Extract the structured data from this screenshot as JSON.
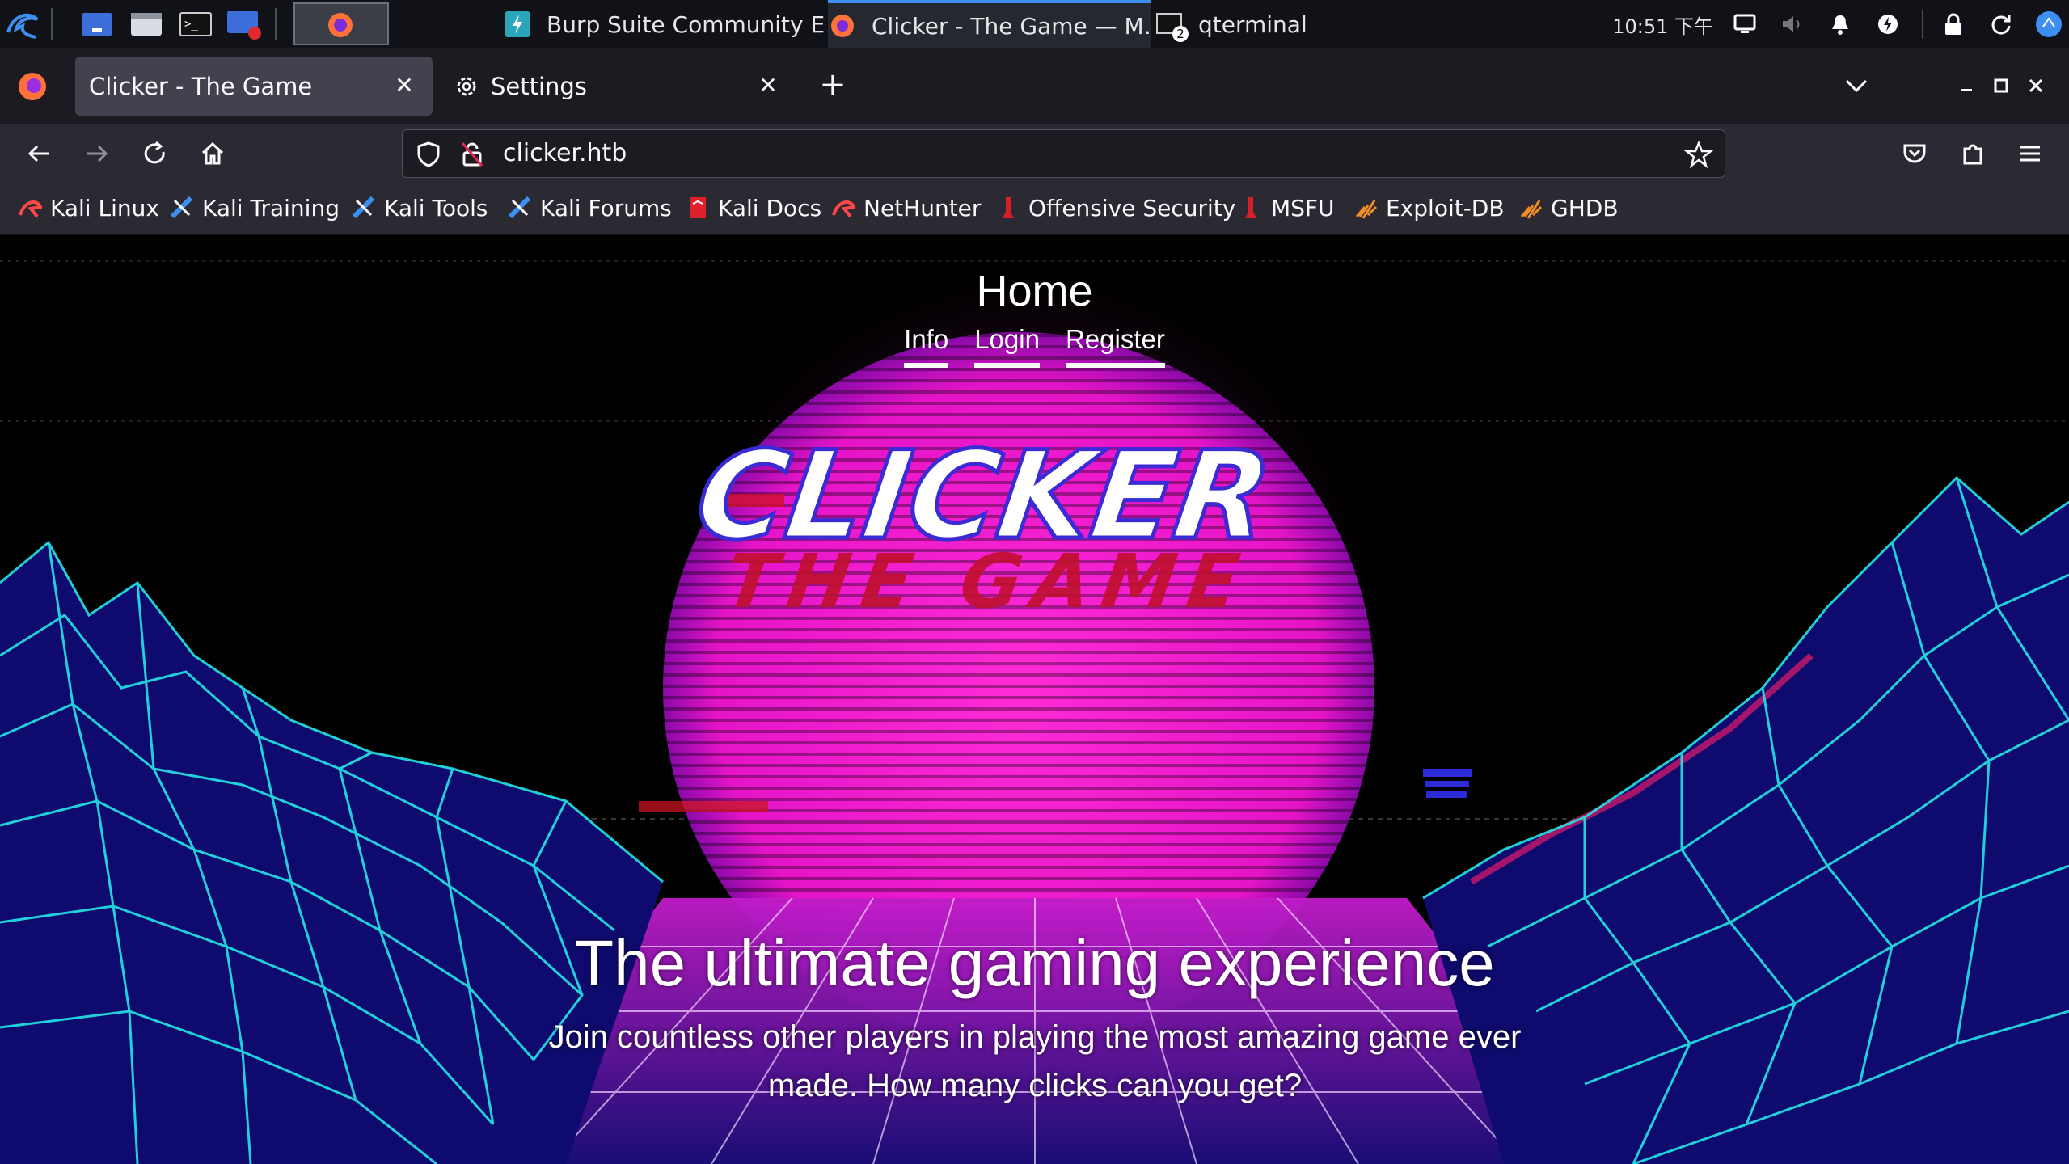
{
  "taskbar": {
    "tasks": [
      {
        "label": "Burp Suite Community E…",
        "icon": "burp-icon"
      },
      {
        "label": "Clicker - The Game — M…",
        "icon": "firefox-icon"
      },
      {
        "label": "qterminal",
        "icon": "terminal-icon",
        "badge": "2"
      }
    ],
    "clock": "10:51 下午"
  },
  "browser": {
    "tabs": [
      {
        "label": "Clicker - The Game",
        "active": true
      },
      {
        "label": "Settings",
        "icon": "gear-icon"
      }
    ],
    "url": "clicker.htb",
    "bookmarks": [
      {
        "label": "Kali Linux",
        "icon": "kali-dragon-icon"
      },
      {
        "label": "Kali Training",
        "icon": "kali-training-icon"
      },
      {
        "label": "Kali Tools",
        "icon": "kali-tools-icon"
      },
      {
        "label": "Kali Forums",
        "icon": "kali-forums-icon"
      },
      {
        "label": "Kali Docs",
        "icon": "kali-docs-icon"
      },
      {
        "label": "NetHunter",
        "icon": "nethunter-icon"
      },
      {
        "label": "Offensive Security",
        "icon": "offsec-icon"
      },
      {
        "label": "MSFU",
        "icon": "offsec-icon"
      },
      {
        "label": "Exploit-DB",
        "icon": "exploitdb-icon"
      },
      {
        "label": "GHDB",
        "icon": "exploitdb-icon"
      }
    ]
  },
  "site": {
    "title": "Home",
    "nav": [
      "Info",
      "Login",
      "Register"
    ],
    "logo_line1": "CLICKER",
    "logo_line2": "THE GAME",
    "hero_title": "The ultimate gaming experience",
    "hero_sub": "Join countless other players in playing the most amazing game ever made. How many clicks can you get?"
  },
  "colors": {
    "sun": "#ff1fd0",
    "grid": "#22e0e0",
    "mountain": "#120a7a",
    "accent": "#3d8ff0"
  }
}
